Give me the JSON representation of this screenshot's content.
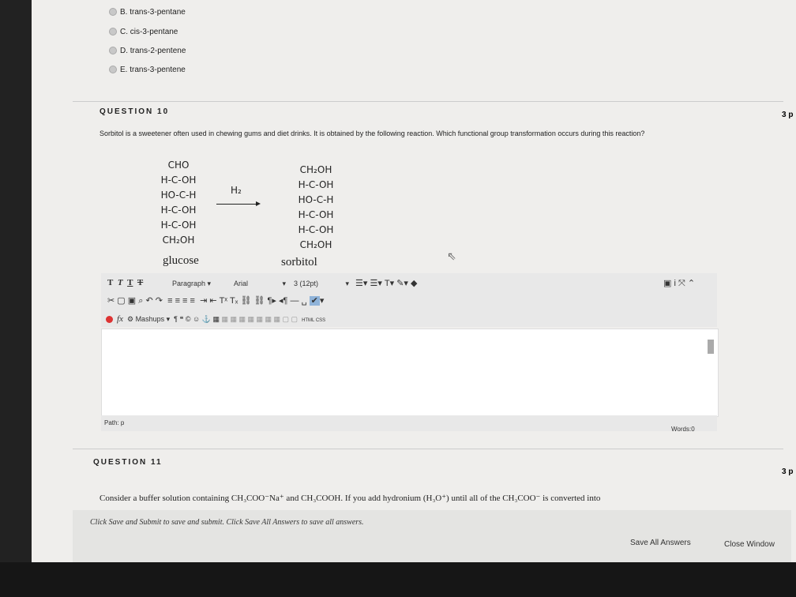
{
  "options": [
    {
      "letter": "B.",
      "text": "trans-3-pentane"
    },
    {
      "letter": "C.",
      "text": "cis-3-pentane"
    },
    {
      "letter": "D.",
      "text": "trans-2-pentene"
    },
    {
      "letter": "E.",
      "text": "trans-3-pentene"
    }
  ],
  "q10": {
    "title": "QUESTION 10",
    "points": "3 p",
    "text": "Sorbitol is a sweetener often used in chewing gums and diet drinks.  It is obtained by the following reaction.  Which functional group transformation occurs during this reaction?",
    "glucose_lines": [
      "CHO",
      "H-C-OH",
      "HO-C-H",
      "H-C-OH",
      "H-C-OH",
      "CH₂OH"
    ],
    "reagent": "H₂",
    "sorbitol_lines": [
      "CH₂OH",
      "H-C-OH",
      "HO-C-H",
      "H-C-OH",
      "H-C-OH",
      "CH₂OH"
    ],
    "glucose_label": "glucose",
    "sorbitol_label": "sorbitol"
  },
  "editor": {
    "paragraph": "Paragraph",
    "font": "Arial",
    "size": "3 (12pt)",
    "mashups": "Mashups",
    "html_css": "HTML CSS",
    "path": "Path: p",
    "words": "Words:0"
  },
  "q11": {
    "title": "QUESTION 11",
    "points": "3 p",
    "text": "Consider a buffer solution containing CH₃COO⁻Na⁺ and CH₃COOH. If you add hydronium (H₃O⁺) until all of the CH₃COO⁻ is converted into"
  },
  "footer": {
    "instructions": "Click Save and Submit to save and submit. Click Save All Answers to save all answers.",
    "save_all": "Save All Answers",
    "close_window": "Close Window"
  },
  "colors": {
    "page_bg": "#efeeec",
    "editor_bg": "#ffffff",
    "bezel": "#1c1c1c"
  }
}
